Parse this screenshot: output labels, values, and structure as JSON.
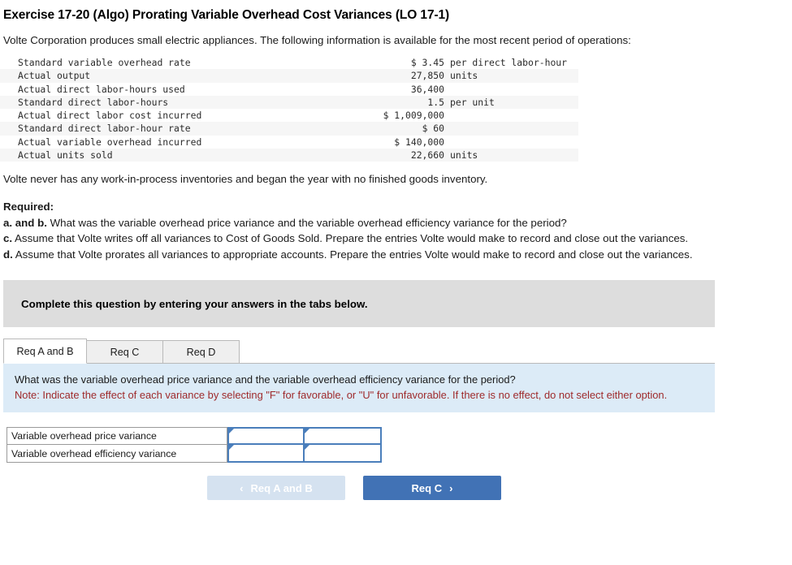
{
  "title": "Exercise 17-20 (Algo) Prorating Variable Overhead Cost Variances (LO 17-1)",
  "intro": "Volte Corporation produces small electric appliances. The following information is available for the most recent period of operations:",
  "facts": [
    {
      "label": "Standard variable overhead rate",
      "amount": "$ 3.45",
      "unit": "per direct labor-hour"
    },
    {
      "label": "Actual output",
      "amount": "27,850",
      "unit": "units"
    },
    {
      "label": "Actual direct labor-hours used",
      "amount": "36,400",
      "unit": ""
    },
    {
      "label": "Standard direct labor-hours",
      "amount": "1.5",
      "unit": "per unit"
    },
    {
      "label": "Actual direct labor cost incurred",
      "amount": "$ 1,009,000",
      "unit": ""
    },
    {
      "label": "Standard direct labor-hour rate",
      "amount": "$ 60",
      "unit": ""
    },
    {
      "label": "Actual variable overhead incurred",
      "amount": "$ 140,000",
      "unit": ""
    },
    {
      "label": "Actual units sold",
      "amount": "22,660",
      "unit": "units"
    }
  ],
  "wip_note": "Volte never has any work-in-process inventories and began the year with no finished goods inventory.",
  "required": {
    "heading": "Required:",
    "items": [
      {
        "marker": "a. and b.",
        "text": " What was the variable overhead price variance and the variable overhead efficiency variance for the period?"
      },
      {
        "marker": "c.",
        "text": " Assume that Volte writes off all variances to Cost of Goods Sold. Prepare the entries Volte would make to record and close out the variances."
      },
      {
        "marker": "d.",
        "text": " Assume that Volte prorates all variances to appropriate accounts. Prepare the entries Volte would make to record and close out the variances."
      }
    ]
  },
  "gray_banner": "Complete this question by entering your answers in the tabs below.",
  "tabs": [
    {
      "label": "Req A and B",
      "active": true
    },
    {
      "label": "Req C",
      "active": false
    },
    {
      "label": "Req D",
      "active": false
    }
  ],
  "panel": {
    "question": "What was the variable overhead price variance and the variable overhead efficiency variance for the period?",
    "note": "Note: Indicate the effect of each variance by selecting \"F\" for favorable, or \"U\" for unfavorable. If there is no effect, do not select either option.",
    "background": "#dcebf7",
    "note_color": "#9e2a2b"
  },
  "answers": [
    {
      "label": "Variable overhead price variance",
      "value": "",
      "effect": ""
    },
    {
      "label": "Variable overhead efficiency variance",
      "value": "",
      "effect": ""
    }
  ],
  "nav": {
    "prev_label": "Req A and B",
    "prev_chevron": "‹",
    "next_label": "Req C",
    "next_chevron": "›",
    "prev_color": "#d5e2f0",
    "next_color": "#4172b5"
  }
}
